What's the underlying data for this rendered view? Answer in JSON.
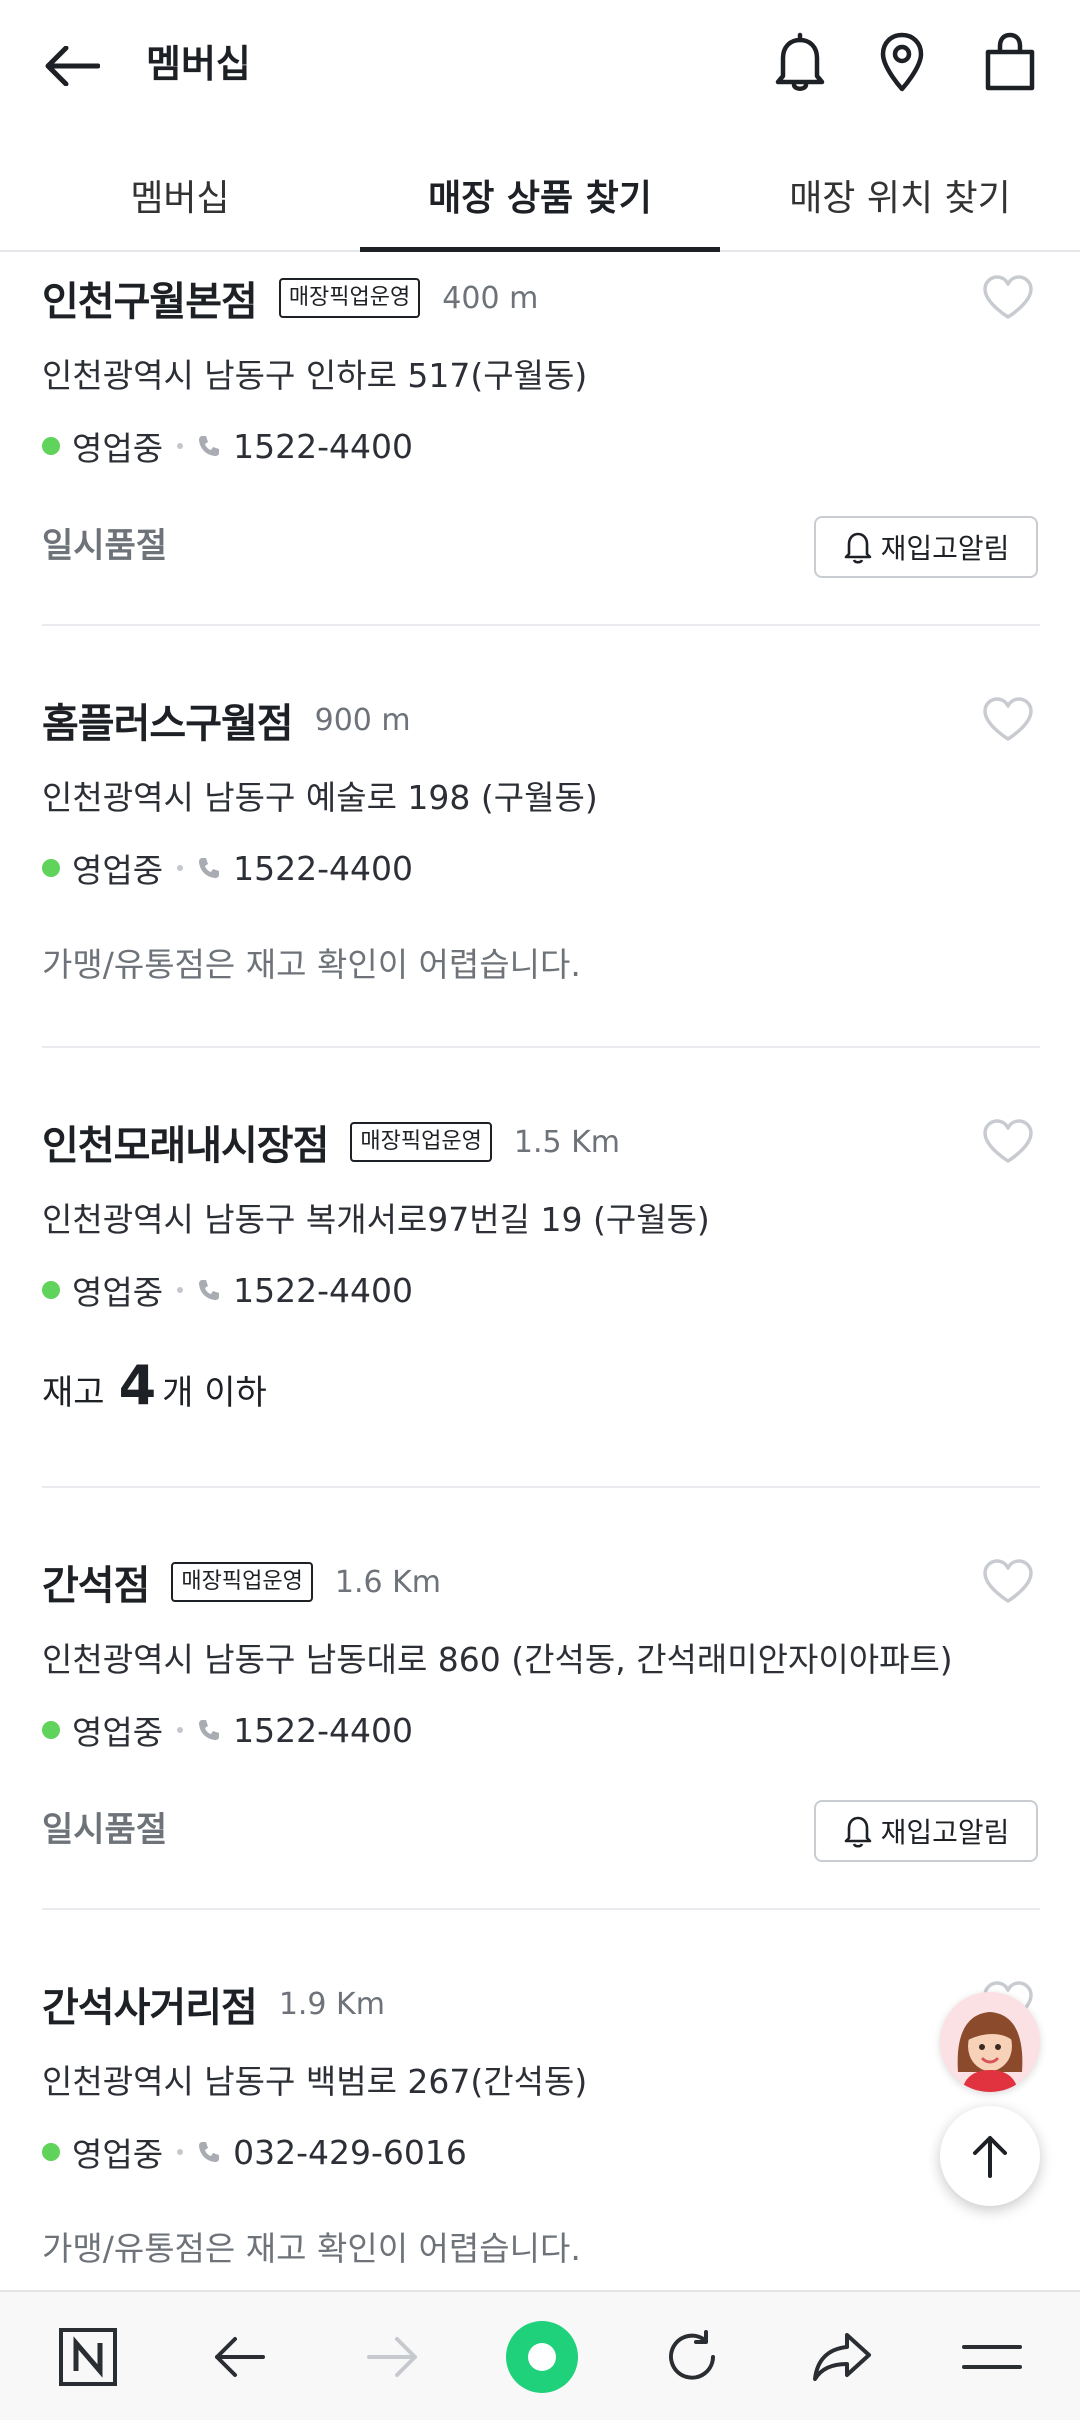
{
  "header": {
    "title": "멤버십",
    "icons": [
      "back-arrow-icon",
      "bell-icon",
      "map-pin-icon",
      "shopping-bag-icon"
    ]
  },
  "tabs": [
    {
      "label": "멤버십",
      "active": false
    },
    {
      "label": "매장 상품 찾기",
      "active": true
    },
    {
      "label": "매장 위치 찾기",
      "active": false
    }
  ],
  "common": {
    "pickup_badge": "매장픽업운영",
    "open_status": "영업중",
    "soldout": "일시품절",
    "restock_label": "재입고알림",
    "franchise_note": "가맹/유통점은 재고 확인이 어렵습니다."
  },
  "stores": [
    {
      "name": "인천구월본점",
      "pickup": true,
      "distance": "400 m",
      "address": "인천광역시 남동구 인하로 517(구월동)",
      "status": "영업중",
      "phone": "1522-4400",
      "availability": "soldout"
    },
    {
      "name": "홈플러스구월점",
      "pickup": false,
      "distance": "900 m",
      "address": "인천광역시 남동구 예술로 198 (구월동)",
      "status": "영업중",
      "phone": "1522-4400",
      "availability": "franchise"
    },
    {
      "name": "인천모래내시장점",
      "pickup": true,
      "distance": "1.5 Km",
      "address": "인천광역시 남동구 복개서로97번길 19 (구월동)",
      "status": "영업중",
      "phone": "1522-4400",
      "availability": "stock",
      "stock_pre": "재고",
      "stock_num": "4",
      "stock_post": "개 이하"
    },
    {
      "name": "간석점",
      "pickup": true,
      "distance": "1.6 Km",
      "address": "인천광역시 남동구 남동대로 860 (간석동, 간석래미안자이아파트)",
      "status": "영업중",
      "phone": "1522-4400",
      "availability": "soldout"
    },
    {
      "name": "간석사거리점",
      "pickup": false,
      "distance": "1.9 Km",
      "address": "인천광역시 남동구 백범로 267(간석동)",
      "status": "영업중",
      "phone": "032-429-6016",
      "availability": "franchise"
    }
  ],
  "colors": {
    "accent": "#1d2025",
    "open_dot": "#5fd35a",
    "muted": "#6e737a",
    "browser_home": "#1ed17a"
  },
  "bottom_bar": {
    "icons": [
      "naver-n-icon",
      "back-icon",
      "forward-icon",
      "home-circle-icon",
      "reload-icon",
      "share-icon",
      "menu-icon"
    ]
  }
}
